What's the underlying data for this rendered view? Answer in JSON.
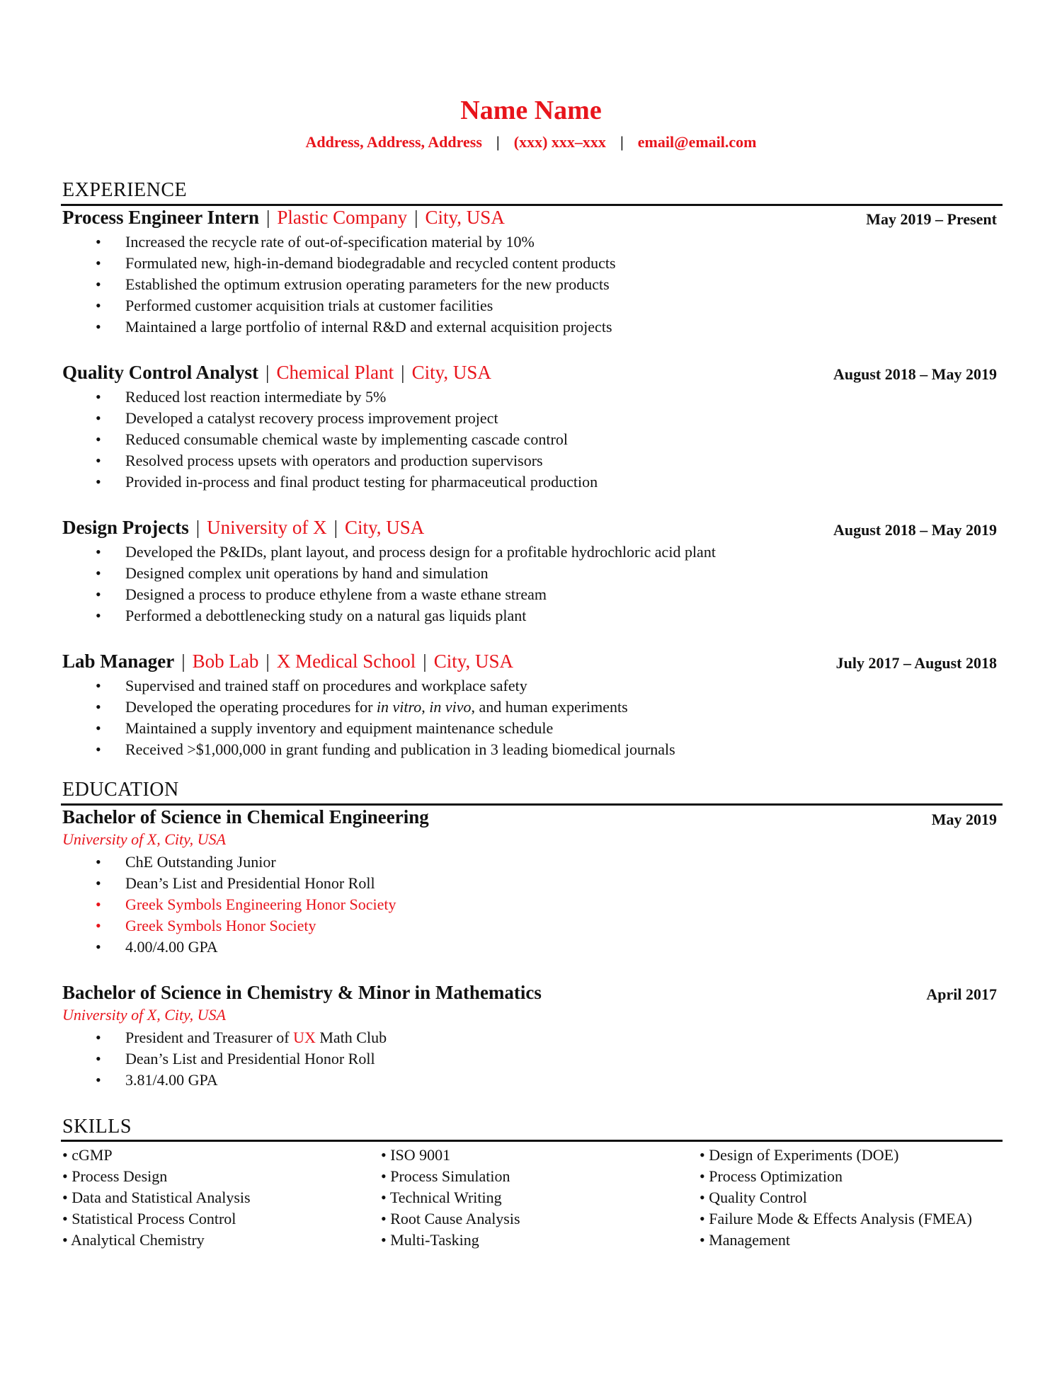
{
  "header": {
    "name": "Name Name",
    "address": "Address, Address, Address",
    "separator": "|",
    "phone": "(xxx) xxx–xxx",
    "email": "email@email.com"
  },
  "colors": {
    "accent": "#e8141b",
    "text": "#111111"
  },
  "bullet_glyph": "•",
  "sections": {
    "experience": "EXPERIENCE",
    "education": "EDUCATION",
    "skills": "SKILLS"
  },
  "experience": [
    {
      "title": "Process Engineer Intern",
      "orgs": [
        "Plastic Company",
        "City, USA"
      ],
      "date": "May 2019 – Present",
      "bullets": [
        "Increased the recycle rate of out-of-specification material by 10%",
        "Formulated new, high-in-demand biodegradable and recycled content products",
        "Established the optimum extrusion operating parameters for the new products",
        "Performed customer acquisition trials at customer facilities",
        "Maintained a large portfolio of internal R&D and external acquisition projects"
      ]
    },
    {
      "title": "Quality Control Analyst",
      "orgs": [
        "Chemical Plant",
        "City, USA"
      ],
      "date": "August 2018 – May 2019",
      "bullets": [
        "Reduced lost reaction intermediate by 5%",
        "Developed a catalyst recovery process improvement project",
        "Reduced consumable chemical waste by implementing cascade control",
        "Resolved process upsets with operators and production supervisors",
        "Provided in-process and final product testing for pharmaceutical production"
      ]
    },
    {
      "title": "Design Projects",
      "orgs": [
        "University of X",
        "City, USA"
      ],
      "date": "August 2018 – May 2019",
      "bullets": [
        "Developed the P&IDs, plant layout, and process design for a profitable hydrochloric acid plant",
        "Designed complex unit operations by hand and simulation",
        "Designed a process to produce ethylene from a waste ethane stream",
        "Performed a debottlenecking study on a natural gas liquids plant"
      ]
    },
    {
      "title": "Lab Manager",
      "orgs": [
        "Bob Lab",
        "X Medical School",
        "City, USA"
      ],
      "date": "July 2017 – August 2018",
      "bullets": [
        "Supervised and trained staff on procedures and workplace safety",
        {
          "pre": "Developed the operating procedures for ",
          "it1": "in vitro",
          "mid": ", ",
          "it2": "in vivo",
          "post": ", and human experiments"
        },
        "Maintained a supply inventory and equipment maintenance schedule",
        "Received >$1,000,000 in grant funding and publication in 3 leading biomedical journals"
      ]
    }
  ],
  "education": [
    {
      "degree": "Bachelor of Science  in Chemical Engineering",
      "school": "University of X, City, USA",
      "date": "May 2019",
      "bullets": [
        {
          "text": "ChE Outstanding Junior",
          "highlight": false
        },
        {
          "text": "Dean’s List and Presidential Honor Roll",
          "highlight": false
        },
        {
          "text": "Greek Symbols Engineering Honor Society",
          "highlight": true
        },
        {
          "text": "Greek Symbols Honor Society",
          "highlight": true
        },
        {
          "text": "4.00/4.00 GPA",
          "highlight": false
        }
      ]
    },
    {
      "degree": "Bachelor of Science in Chemistry & Minor in Mathematics",
      "school": "University of X, City, USA",
      "date": "April 2017",
      "bullets": [
        {
          "pre": "President and Treasurer of ",
          "red": "UX",
          "post": " Math Club"
        },
        {
          "text": "Dean’s List and Presidential Honor Roll"
        },
        {
          "text": "3.81/4.00 GPA"
        }
      ]
    }
  ],
  "skills": {
    "col1": [
      "cGMP",
      "Process Design",
      "Data and Statistical Analysis",
      "Statistical Process Control",
      "Analytical Chemistry"
    ],
    "col2": [
      "ISO 9001",
      "Process Simulation",
      "Technical Writing",
      "Root Cause Analysis",
      "Multi-Tasking"
    ],
    "col3": [
      "Design of Experiments (DOE)",
      "Process Optimization",
      "Quality Control",
      "Failure Mode & Effects Analysis (FMEA)",
      "Management"
    ]
  }
}
